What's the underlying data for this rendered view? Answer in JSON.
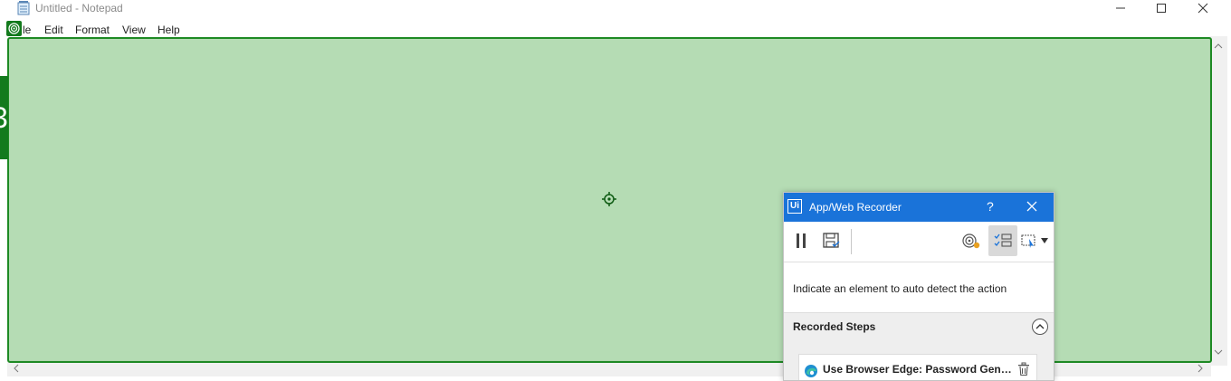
{
  "window": {
    "title": "Untitled - Notepad",
    "controls": [
      "minimize-icon",
      "maximize-icon",
      "close-icon"
    ]
  },
  "menu": {
    "file": "le",
    "edit": "Edit",
    "format": "Format",
    "view": "View",
    "help": "Help"
  },
  "highlight": {
    "color": "#6bb969",
    "border_color": "#1e8a24",
    "side_glyph": "3"
  },
  "recorder": {
    "logo": "Ui",
    "title": "App/Web Recorder",
    "help": "?",
    "header_color": "#1a73d9",
    "toolbar": [
      "pause-icon",
      "save-icon",
      "target-record-icon",
      "recorded-steps-toggle-icon",
      "screen-capture-dropdown-icon"
    ],
    "instruction": "Indicate an element to auto detect the action",
    "steps_title": "Recorded Steps",
    "steps": [
      {
        "label": "Use Browser Edge: Password Genera...",
        "icon": "edge-browser-icon"
      }
    ]
  }
}
